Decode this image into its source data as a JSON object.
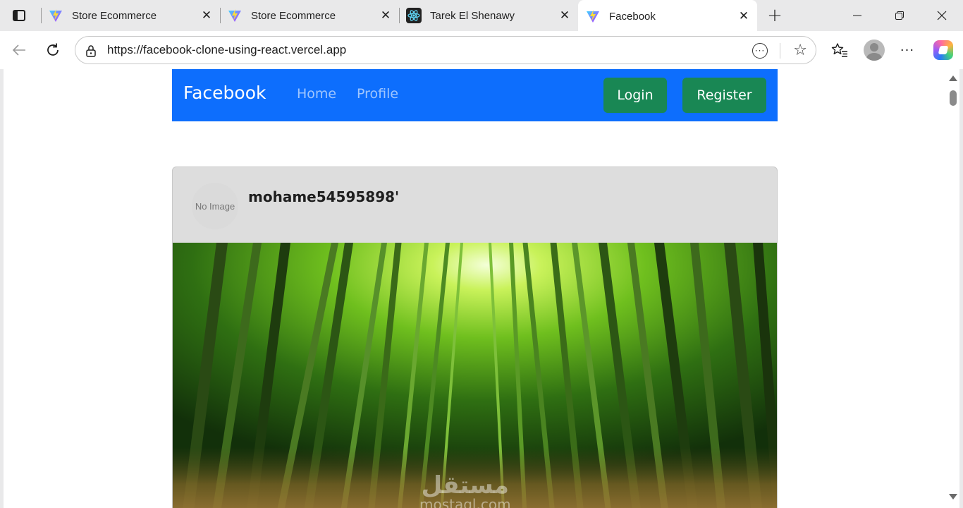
{
  "tabs": [
    {
      "title": "Store Ecommerce",
      "icon": "vite-icon"
    },
    {
      "title": "Store Ecommerce",
      "icon": "vite-icon"
    },
    {
      "title": "Tarek El Shenawy",
      "icon": "react-icon"
    },
    {
      "title": "Facebook",
      "icon": "vite-icon",
      "active": true
    }
  ],
  "toolbar": {
    "url": "https://facebook-clone-using-react.vercel.app"
  },
  "app": {
    "brand": "Facebook",
    "nav": {
      "home": "Home",
      "profile": "Profile"
    },
    "buttons": {
      "login": "Login",
      "register": "Register"
    }
  },
  "post": {
    "avatar_placeholder": "No Image",
    "username": "mohame54595898'"
  },
  "watermark": {
    "arabic": "مستقل",
    "latin": "mostaql.com"
  },
  "colors": {
    "navbar": "#0d6efd",
    "button": "#198754",
    "card": "#dddddd",
    "browser_chrome": "#e9e9ea"
  }
}
